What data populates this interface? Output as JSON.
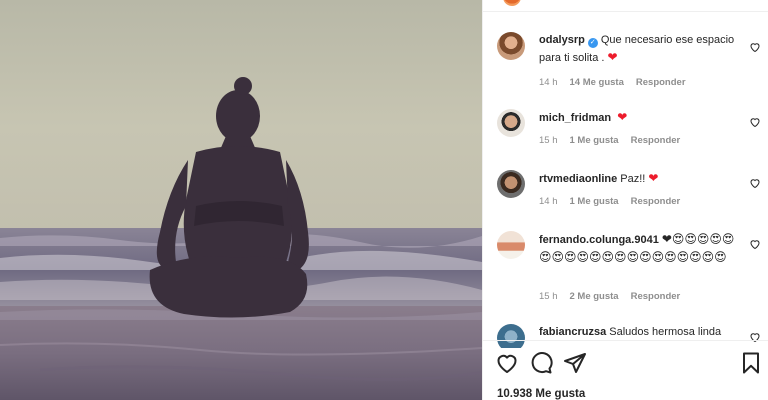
{
  "post": {
    "image_alt": "",
    "likes_count": "10.938",
    "likes_label": "Me gusta"
  },
  "comments": [
    {
      "username": "odalysrp",
      "verified": true,
      "text": "Que necesario ese espacio para ti solita .",
      "emoji": "❤",
      "time": "14 h",
      "likes": "14 Me gusta",
      "reply": "Responder",
      "avatar": "portrait-avatar"
    },
    {
      "username": "mich_fridman",
      "verified": false,
      "text": "",
      "emoji": "❤",
      "time": "15 h",
      "likes": "1 Me gusta",
      "reply": "Responder",
      "avatar": "sunglasses-avatar"
    },
    {
      "username": "rtvmediaonline",
      "verified": false,
      "text": "Paz!!",
      "emoji": "❤",
      "time": "14 h",
      "likes": "1 Me gusta",
      "reply": "Responder",
      "avatar": "beard-avatar"
    },
    {
      "username": "fernando.colunga.9041",
      "verified": false,
      "text": "",
      "emoji": "❤😍😍😍😍😍😍😍😍😍😍😍😍😍😍😍😍😍😍😍😍",
      "time": "15 h",
      "likes": "2 Me gusta",
      "reply": "Responder",
      "avatar": "group-avatar"
    },
    {
      "username": "fabiancruzsa",
      "verified": false,
      "text": "Saludos hermosa linda",
      "emoji": "",
      "time": "",
      "likes": "",
      "reply": "",
      "avatar": "blue-avatar"
    }
  ],
  "icons": {
    "like": "heart-outline-icon",
    "comment": "speech-bubble-icon",
    "share": "paper-plane-icon",
    "save": "bookmark-icon"
  },
  "colors": {
    "heart": "#ed1c2c",
    "meta_text": "#8e8e8e",
    "verified": "#3897f0"
  }
}
